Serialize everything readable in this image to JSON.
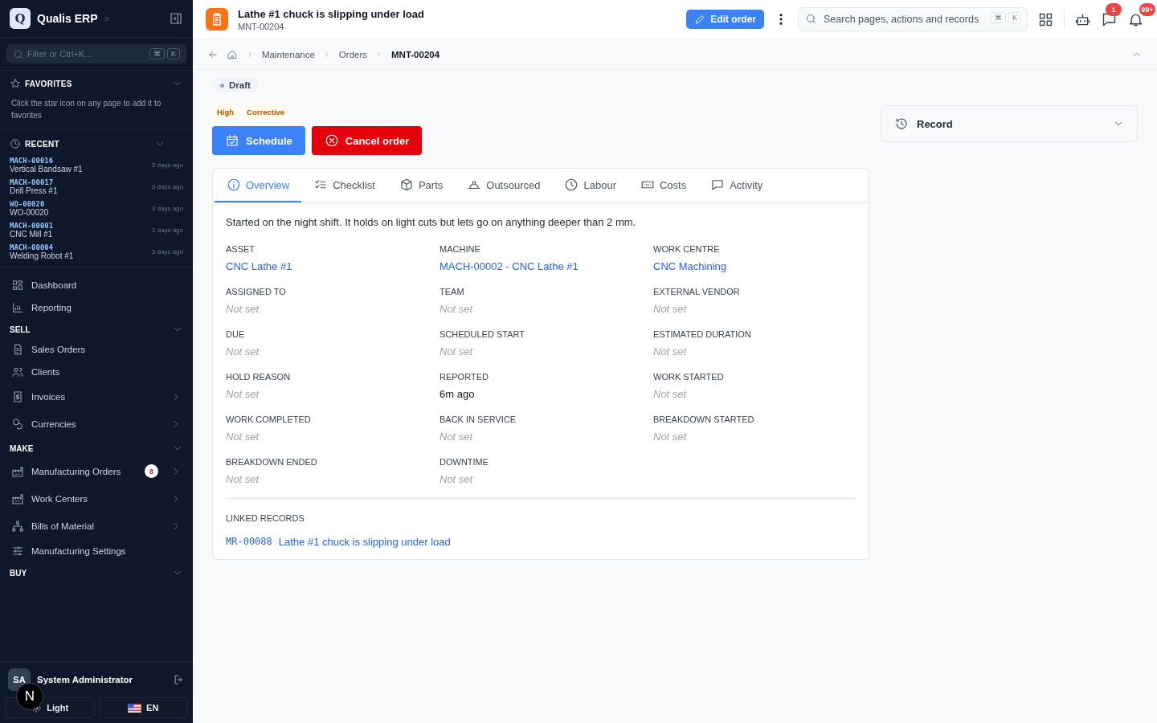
{
  "sidebar": {
    "brand": {
      "logo": "Q",
      "name": "Qualis ERP",
      "chevron": "»"
    },
    "filter": {
      "placeholder": "Filter or Ctrl+K...",
      "keys": [
        "⌘",
        "K"
      ]
    },
    "favorites": {
      "title": "FAVORITES",
      "hint": "Click the star icon on any page to add it to favorites"
    },
    "recent": {
      "title": "RECENT",
      "items": [
        {
          "code": "MACH-00016",
          "name": "Vertical Bandsaw #1",
          "time": "3 days ago"
        },
        {
          "code": "MACH-00017",
          "name": "Drill Press #1",
          "time": "3 days ago"
        },
        {
          "code": "WO-00020",
          "name": "WO-00020",
          "time": "3 days ago"
        },
        {
          "code": "MACH-00001",
          "name": "CNC Mill #1",
          "time": "3 days ago"
        },
        {
          "code": "MACH-00004",
          "name": "Welding Robot #1",
          "time": "3 days ago"
        }
      ]
    },
    "nav": [
      {
        "kind": "item",
        "label": "Dashboard",
        "has_submenu": false
      },
      {
        "kind": "item",
        "label": "Reporting",
        "has_submenu": false
      },
      {
        "kind": "section",
        "label": "SELL"
      },
      {
        "kind": "item",
        "label": "Sales Orders",
        "has_submenu": false
      },
      {
        "kind": "item",
        "label": "Clients",
        "has_submenu": false
      },
      {
        "kind": "item",
        "label": "Invoices",
        "has_submenu": true
      },
      {
        "kind": "item",
        "label": "Currencies",
        "has_submenu": true
      },
      {
        "kind": "section",
        "label": "MAKE"
      },
      {
        "kind": "item",
        "label": "Manufacturing Orders",
        "has_submenu": true,
        "badge": "8"
      },
      {
        "kind": "item",
        "label": "Work Centers",
        "has_submenu": true
      },
      {
        "kind": "item",
        "label": "Bills of Material",
        "has_submenu": true
      },
      {
        "kind": "item",
        "label": "Manufacturing Settings",
        "has_submenu": false
      },
      {
        "kind": "section",
        "label": "BUY"
      }
    ],
    "user": {
      "initials": "SA",
      "name": "System Administrator"
    },
    "dev_indicator": "N",
    "theme_button": "Light",
    "language_button": "EN"
  },
  "header": {
    "title": "Lathe #1 chuck is slipping under load",
    "subtitle": "MNT-00204",
    "edit_button": "Edit order",
    "search": {
      "placeholder": "Search pages, actions and records",
      "keys": [
        "⌘",
        "K"
      ]
    },
    "messages_badge": "1",
    "notifications_badge": "99+"
  },
  "breadcrumb": [
    "Maintenance",
    "Orders",
    "MNT-00204"
  ],
  "status": "Draft",
  "tags": [
    "High",
    "Corrective"
  ],
  "actions": [
    {
      "kind": "primary",
      "label": "Schedule"
    },
    {
      "kind": "danger",
      "label": "Cancel order"
    }
  ],
  "tabs": [
    {
      "label": "Overview",
      "selected": true
    },
    {
      "label": "Checklist",
      "selected": false
    },
    {
      "label": "Parts",
      "selected": false
    },
    {
      "label": "Outsourced",
      "selected": false
    },
    {
      "label": "Labour",
      "selected": false
    },
    {
      "label": "Costs",
      "selected": false
    },
    {
      "label": "Activity",
      "selected": false
    }
  ],
  "description": "Started on the night shift. It holds on light cuts but lets go on anything deeper than 2 mm.",
  "fields": [
    {
      "label": "ASSET",
      "value": "CNC Lathe #1",
      "kind": "link"
    },
    {
      "label": "MACHINE",
      "value": "MACH-00002 - CNC Lathe #1",
      "kind": "link"
    },
    {
      "label": "WORK CENTRE",
      "value": "CNC Machining",
      "kind": "link"
    },
    {
      "label": "ASSIGNED TO",
      "value": "Not set",
      "kind": "unset"
    },
    {
      "label": "TEAM",
      "value": "Not set",
      "kind": "unset"
    },
    {
      "label": "EXTERNAL VENDOR",
      "value": "Not set",
      "kind": "unset"
    },
    {
      "label": "DUE",
      "value": "Not set",
      "kind": "unset"
    },
    {
      "label": "SCHEDULED START",
      "value": "Not set",
      "kind": "unset"
    },
    {
      "label": "ESTIMATED DURATION",
      "value": "Not set",
      "kind": "unset"
    },
    {
      "label": "HOLD REASON",
      "value": "Not set",
      "kind": "unset"
    },
    {
      "label": "REPORTED",
      "value": "6m ago",
      "kind": "text"
    },
    {
      "label": "WORK STARTED",
      "value": "Not set",
      "kind": "unset"
    },
    {
      "label": "WORK COMPLETED",
      "value": "Not set",
      "kind": "unset"
    },
    {
      "label": "BACK IN SERVICE",
      "value": "Not set",
      "kind": "unset"
    },
    {
      "label": "BREAKDOWN STARTED",
      "value": "Not set",
      "kind": "unset"
    },
    {
      "label": "BREAKDOWN ENDED",
      "value": "Not set",
      "kind": "unset"
    },
    {
      "label": "DOWNTIME",
      "value": "Not set",
      "kind": "unset"
    }
  ],
  "linked": {
    "title": "LINKED RECORDS",
    "items": [
      {
        "code": "MR-00088",
        "title": "Lathe #1 chuck is slipping under load"
      }
    ]
  },
  "record_panel": {
    "title": "Record",
    "expanded": false
  }
}
